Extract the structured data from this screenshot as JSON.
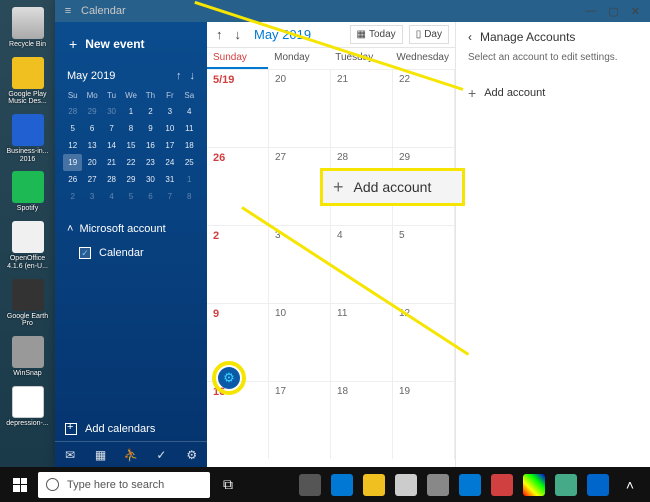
{
  "desktop_icons": [
    {
      "label": "Recycle Bin",
      "cls": "recyclebin"
    },
    {
      "label": "Google Play Music Des...",
      "cls": "icon-yellow"
    },
    {
      "label": "Business-in... 2016",
      "cls": "icon-blue"
    },
    {
      "label": "Spotify",
      "cls": "icon-green"
    },
    {
      "label": "OpenOffice 4.1.6 (en-U...",
      "cls": "icon-white"
    },
    {
      "label": "Google Earth Pro",
      "cls": "icon-dark"
    },
    {
      "label": "WinSnap",
      "cls": "icon-gray"
    },
    {
      "label": "depression-...",
      "cls": "icon-doc"
    }
  ],
  "app": {
    "title": "Calendar",
    "window_controls": {
      "min": "—",
      "max": "▢",
      "close": "✕"
    }
  },
  "sidebar": {
    "new_event": "New event",
    "mini_month": "May 2019",
    "dow": [
      "Su",
      "Mo",
      "Tu",
      "We",
      "Th",
      "Fr",
      "Sa"
    ],
    "weeks": [
      [
        {
          "d": "28",
          "dim": true
        },
        {
          "d": "29",
          "dim": true
        },
        {
          "d": "30",
          "dim": true
        },
        {
          "d": "1"
        },
        {
          "d": "2"
        },
        {
          "d": "3"
        },
        {
          "d": "4"
        }
      ],
      [
        {
          "d": "5"
        },
        {
          "d": "6"
        },
        {
          "d": "7"
        },
        {
          "d": "8"
        },
        {
          "d": "9"
        },
        {
          "d": "10"
        },
        {
          "d": "11"
        }
      ],
      [
        {
          "d": "12"
        },
        {
          "d": "13"
        },
        {
          "d": "14"
        },
        {
          "d": "15"
        },
        {
          "d": "16"
        },
        {
          "d": "17"
        },
        {
          "d": "18"
        }
      ],
      [
        {
          "d": "19",
          "today": true
        },
        {
          "d": "20"
        },
        {
          "d": "21"
        },
        {
          "d": "22"
        },
        {
          "d": "23"
        },
        {
          "d": "24"
        },
        {
          "d": "25"
        }
      ],
      [
        {
          "d": "26"
        },
        {
          "d": "27"
        },
        {
          "d": "28"
        },
        {
          "d": "29"
        },
        {
          "d": "30"
        },
        {
          "d": "31"
        },
        {
          "d": "1",
          "dim": true
        }
      ],
      [
        {
          "d": "2",
          "dim": true
        },
        {
          "d": "3",
          "dim": true
        },
        {
          "d": "4",
          "dim": true
        },
        {
          "d": "5",
          "dim": true
        },
        {
          "d": "6",
          "dim": true
        },
        {
          "d": "7",
          "dim": true
        },
        {
          "d": "8",
          "dim": true
        }
      ]
    ],
    "account_header": "Microsoft account",
    "account_item": "Calendar",
    "add_calendars": "Add calendars"
  },
  "main": {
    "month": "May 2019",
    "today_btn": "Today",
    "day_btn": "Day",
    "dow": [
      "Sunday",
      "Monday",
      "Tuesday",
      "Wednesday"
    ],
    "rows": [
      [
        "5/19",
        "20",
        "21",
        "22"
      ],
      [
        "26",
        "27",
        "28",
        "29"
      ],
      [
        "2",
        "3",
        "4",
        "5"
      ],
      [
        "9",
        "10",
        "11",
        "12"
      ],
      [
        "16",
        "17",
        "18",
        "19"
      ]
    ]
  },
  "right_panel": {
    "title": "Manage Accounts",
    "subtitle": "Select an account to edit settings.",
    "add_account": "Add account"
  },
  "callout": {
    "label": "Add account"
  },
  "taskbar": {
    "search_placeholder": "Type here to search"
  }
}
